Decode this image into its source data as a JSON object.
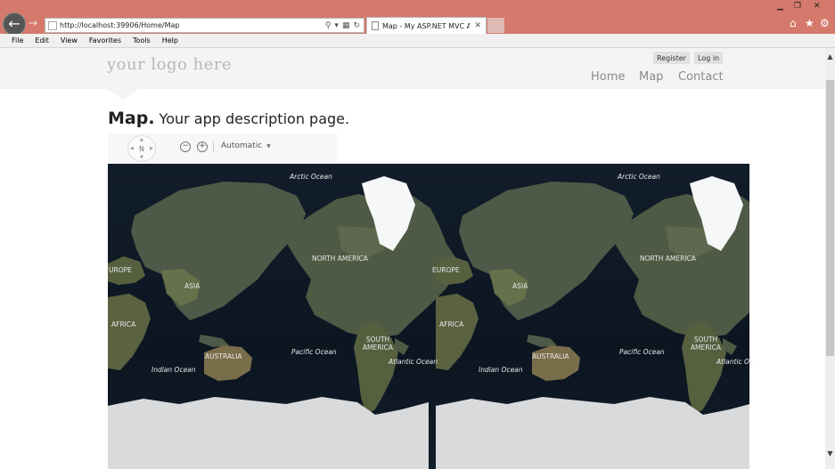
{
  "browser": {
    "url": "http://localhost:39906/Home/Map",
    "tab_title": "Map - My ASP.NET MVC A...",
    "tab_close": "✕",
    "menu": [
      "File",
      "Edit",
      "View",
      "Favorites",
      "Tools",
      "Help"
    ],
    "colors": {
      "titlebar": "#d4796b"
    }
  },
  "site": {
    "logo": "your logo here",
    "register": "Register",
    "login": "Log in",
    "nav": [
      "Home",
      "Map",
      "Contact"
    ]
  },
  "page": {
    "title": "Map.",
    "subtitle": "Your app description page."
  },
  "map": {
    "compass": "N",
    "zoom_out": "−",
    "zoom_in": "+",
    "map_type": "Automatic",
    "labels": [
      "Arctic Ocean",
      "NORTH AMERICA",
      "UROPE",
      "ASIA",
      "AFRICA",
      "AUSTRALIA",
      "Indian Ocean",
      "Pacific Ocean",
      "SOUTH AMERICA",
      "Atlantic Ocean",
      "Arctic Ocean",
      "EUROPE",
      "ASIA",
      "NORTH AMERICA",
      "AFRICA",
      "AUSTRALIA",
      "Indian Ocean",
      "Pacific Ocean",
      "SOUTH AMERICA",
      "Atlantic Oc"
    ]
  },
  "icons": {
    "back": "arrow-left",
    "forward": "arrow-right",
    "home": "home",
    "favorites": "star",
    "settings": "gear"
  }
}
